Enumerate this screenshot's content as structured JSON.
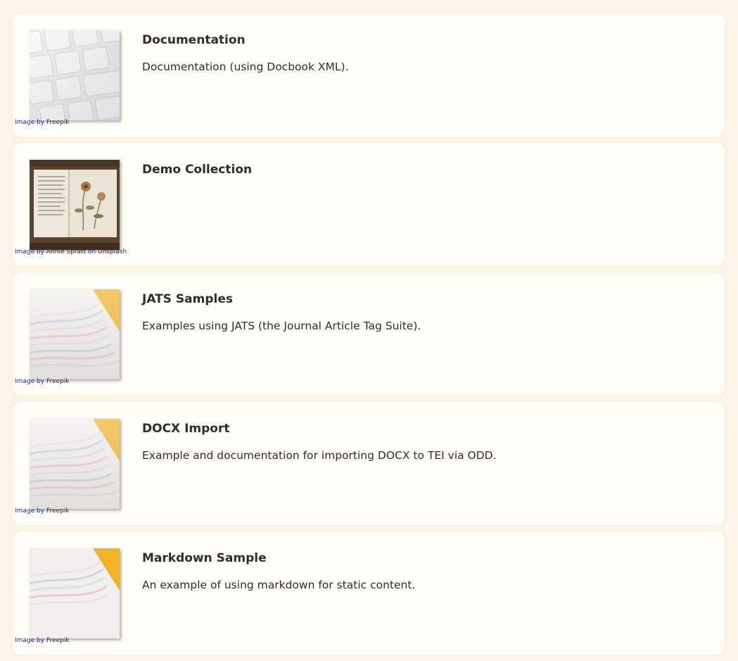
{
  "cards": [
    {
      "title": "Documentation",
      "description": "Documentation (using Docbook XML).",
      "image": "keyboard-image",
      "credit": {
        "prefix": "Image by",
        "author": "Freepik"
      }
    },
    {
      "title": "Demo Collection",
      "description": "",
      "image": "pressed-flower-book-image",
      "credit": {
        "prefix": "Image by",
        "author": "Annie Spratt",
        "on": "on",
        "site": "Unsplash"
      }
    },
    {
      "title": "JATS Samples",
      "description": "Examples using JATS (the Journal Article Tag Suite).",
      "image": "magazine-stack-image",
      "credit": {
        "prefix": "Image by",
        "author": "Freepik"
      }
    },
    {
      "title": "DOCX Import",
      "description": "Example and documentation for importing DOCX to TEI via ODD.",
      "image": "magazine-stack-image",
      "credit": {
        "prefix": "Image by",
        "author": "Freepik"
      }
    },
    {
      "title": "Markdown Sample",
      "description": "An example of using markdown for static content.",
      "image": "magazine-stack-image",
      "credit": {
        "prefix": "Image by",
        "author": "Freepik"
      }
    }
  ]
}
